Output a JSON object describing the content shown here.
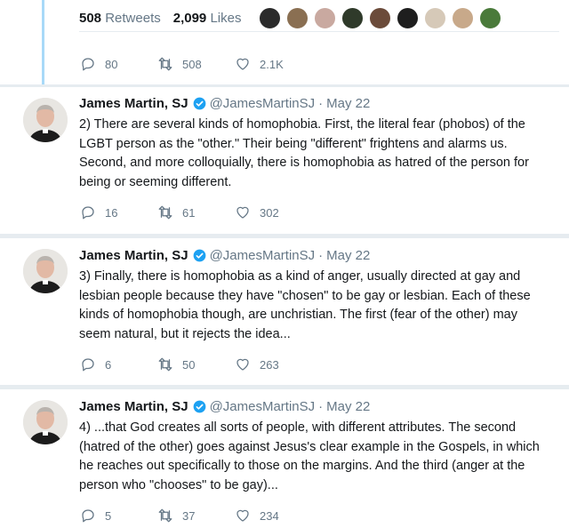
{
  "stats": {
    "retweets_count": "508",
    "retweets_label": "Retweets",
    "likes_count": "2,099",
    "likes_label": "Likes",
    "liker_avatar_colors": [
      "#2b2b2b",
      "#8a6f52",
      "#c9a9a0",
      "#2f3a2a",
      "#6b4b3a",
      "#1e1e1e",
      "#d6c9b8",
      "#c8a98a",
      "#4a7a3a"
    ]
  },
  "top_actions": {
    "replies": "80",
    "retweets": "508",
    "likes": "2.1K"
  },
  "tweets": [
    {
      "name": "James Martin, SJ",
      "handle": "@JamesMartinSJ",
      "separator": "·",
      "date": "May 22",
      "text": "2) There are several kinds of homophobia. First, the literal fear (phobos) of the LGBT person as the \"other.\" Their being \"different\" frightens and alarms us. Second, and more colloquially, there is homophobia as hatred of the person for being or seeming different.",
      "replies": "16",
      "retweets": "61",
      "likes": "302"
    },
    {
      "name": "James Martin, SJ",
      "handle": "@JamesMartinSJ",
      "separator": "·",
      "date": "May 22",
      "text": "3) Finally, there is homophobia as a kind of anger, usually directed at gay and lesbian people because they have \"chosen\" to be gay or lesbian.  Each of these kinds of homophobia though, are unchristian. The first (fear of the other) may seem natural, but it rejects the idea...",
      "replies": "6",
      "retweets": "50",
      "likes": "263"
    },
    {
      "name": "James Martin, SJ",
      "handle": "@JamesMartinSJ",
      "separator": "·",
      "date": "May 22",
      "text": "4) ...that God creates all sorts of people, with different attributes. The second (hatred of the other) goes against Jesus's clear example in the Gospels, in which he reaches out specifically to those on the margins. And the third (anger at the person who \"chooses\" to be gay)...",
      "replies": "5",
      "retweets": "37",
      "likes": "234"
    }
  ],
  "colors": {
    "thread_line": "#a8d9f8",
    "verified_badge": "#1da1f2",
    "muted_text": "#657786",
    "divider": "#e6ecf0"
  },
  "icons": [
    "reply-icon",
    "retweet-icon",
    "like-icon",
    "verified-badge-icon"
  ]
}
